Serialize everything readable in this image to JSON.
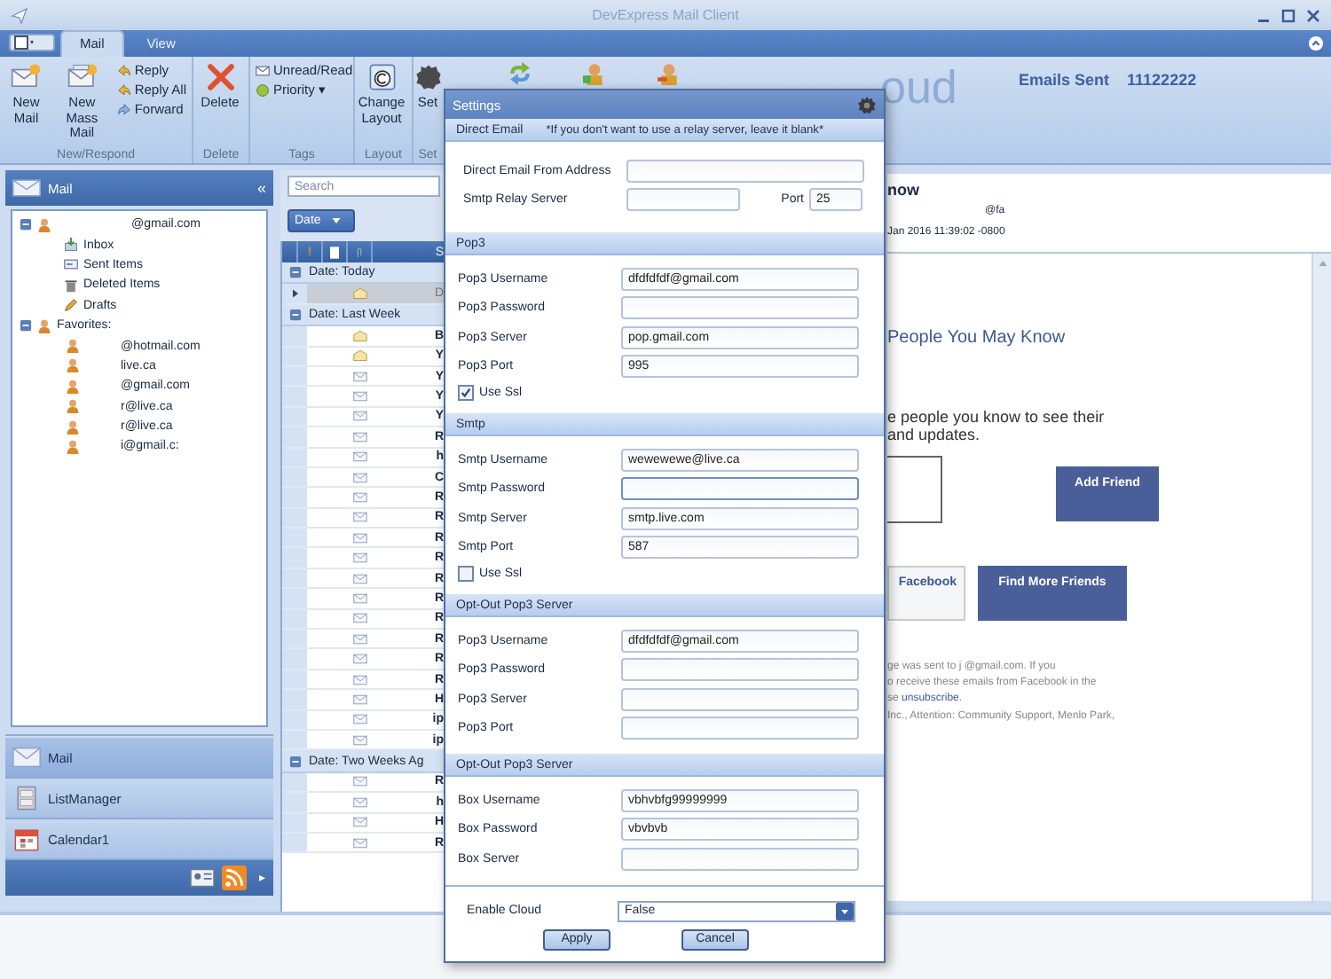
{
  "window": {
    "title": "DevExpress Mail Client"
  },
  "tabs": [
    {
      "label": "Mail",
      "selected": true
    },
    {
      "label": "View",
      "selected": false
    }
  ],
  "ribbon": {
    "groups": [
      {
        "label": "New/Respond",
        "large": [
          "New Mail",
          "New Mass Mail"
        ],
        "small": [
          "Reply",
          "Reply All",
          "Forward"
        ]
      },
      {
        "label": "Delete",
        "large": [
          "Delete"
        ]
      },
      {
        "label": "Tags",
        "small": [
          "Unread/Read",
          "Priority ▾"
        ]
      },
      {
        "label": "Layout",
        "large": [
          "Change Layout"
        ]
      },
      {
        "label": "Set",
        "large": [
          "Set"
        ]
      }
    ],
    "logo": "oud",
    "emails_sent_label": "Emails Sent",
    "emails_sent_value": "11122222"
  },
  "nav": {
    "header": "Mail",
    "collapse": "«",
    "tree": [
      {
        "label": "@gmail.com",
        "expanded": true,
        "children": [
          {
            "label": "Inbox",
            "kind": "inbox"
          },
          {
            "label": "Sent Items",
            "kind": "sent"
          },
          {
            "label": "Deleted Items",
            "kind": "deleted"
          },
          {
            "label": "Drafts",
            "kind": "drafts"
          }
        ]
      },
      {
        "label": "Favorites:",
        "expanded": true,
        "children": [
          {
            "label": "@hotmail.com",
            "kind": "contact"
          },
          {
            "label": "live.ca",
            "kind": "contact"
          },
          {
            "label": "@gmail.com",
            "kind": "contact"
          },
          {
            "label": "r@live.ca",
            "kind": "contact"
          },
          {
            "label": "r@live.ca",
            "kind": "contact"
          },
          {
            "label": "i@gmail.c:",
            "kind": "contact"
          }
        ]
      }
    ],
    "buttons": [
      {
        "label": "Mail",
        "kind": "mail"
      },
      {
        "label": "ListManager",
        "kind": "list"
      },
      {
        "label": "Calendar1",
        "kind": "calendar"
      }
    ],
    "more": "▸"
  },
  "list": {
    "search": {
      "placeholder": "Search"
    },
    "sort": "Date",
    "header": [
      "!",
      "S"
    ],
    "groups": [
      {
        "label": "Date: Today",
        "expanded": true,
        "rows": [
          {
            "sender": "D",
            "read": true,
            "selected": true
          }
        ]
      },
      {
        "label": "Date: Last Week",
        "expanded": true,
        "rows": [
          {
            "sender": "B",
            "read": true,
            "selected": false
          },
          {
            "sender": "Y",
            "read": true,
            "selected": false
          },
          {
            "sender": "Y",
            "read": false,
            "selected": false
          },
          {
            "sender": "Y",
            "read": false,
            "selected": false
          },
          {
            "sender": "Y",
            "read": false,
            "selected": false
          },
          {
            "sender": "R",
            "read": false,
            "selected": false
          },
          {
            "sender": "h",
            "read": false,
            "selected": false
          },
          {
            "sender": "C",
            "read": false,
            "selected": false
          },
          {
            "sender": "R",
            "read": false,
            "selected": false
          },
          {
            "sender": "R",
            "read": false,
            "selected": false
          },
          {
            "sender": "R",
            "read": false,
            "selected": false
          },
          {
            "sender": "R",
            "read": false,
            "selected": false
          },
          {
            "sender": "R",
            "read": false,
            "selected": false
          },
          {
            "sender": "R",
            "read": false,
            "selected": false
          },
          {
            "sender": "R",
            "read": false,
            "selected": false
          },
          {
            "sender": "R",
            "read": false,
            "selected": false
          },
          {
            "sender": "R",
            "read": false,
            "selected": false
          },
          {
            "sender": "R",
            "read": false,
            "selected": false
          },
          {
            "sender": "H",
            "read": false,
            "selected": false
          },
          {
            "sender": "ip",
            "read": false,
            "selected": false
          },
          {
            "sender": "ip",
            "read": false,
            "selected": false
          }
        ]
      },
      {
        "label": "Date: Two Weeks Ag",
        "expanded": true,
        "rows": [
          {
            "sender": "R",
            "read": false,
            "selected": false
          },
          {
            "sender": "h",
            "read": false,
            "selected": false
          },
          {
            "sender": "H",
            "read": false,
            "selected": false
          },
          {
            "sender": "R",
            "read": false,
            "selected": false
          }
        ]
      }
    ]
  },
  "reading": {
    "subject": "now",
    "from": "@fa",
    "date": "Jan 2016 11:39:02 -0800",
    "heading": "People You May Know",
    "intro": [
      "e people you know to see  their",
      "and updates."
    ],
    "add_friend": "Add Friend",
    "facebook": "Facebook",
    "find_friends": "Find More Friends",
    "footer": [
      "ge was sent to j              @gmail.com. If you",
      "o receive these emails from Facebook in the",
      "se **unsubscribe**.",
      "Inc.,  Attention: Community Support, Menlo Park,"
    ]
  },
  "settings": {
    "title": "Settings",
    "sections": [
      {
        "title": "Direct Email",
        "note": "*If you don't want to use a relay server, leave it blank*",
        "fields": [
          {
            "kind": "text",
            "label": "Direct Email From Address"
          },
          {
            "kind": "relay",
            "label": "Smtp Relay Server",
            "port_label": "Port",
            "port_value": "25"
          }
        ]
      },
      {
        "title": "Pop3",
        "fields": [
          {
            "kind": "text",
            "label": "Pop3 Username",
            "value": "dfdfdfdf@gmail.com"
          },
          {
            "kind": "text",
            "label": "Pop3 Password"
          },
          {
            "kind": "text",
            "label": "Pop3 Server",
            "value": "pop.gmail.com"
          },
          {
            "kind": "text",
            "label": "Pop3 Port",
            "value": "995"
          },
          {
            "kind": "checkbox",
            "label": "Use Ssl",
            "checked": true
          }
        ]
      },
      {
        "title": "Smtp",
        "fields": [
          {
            "kind": "text",
            "label": "Smtp Username",
            "value": "wewewewe@live.ca"
          },
          {
            "kind": "text",
            "label": "Smtp Password",
            "focused": true
          },
          {
            "kind": "text",
            "label": "Smtp Server",
            "value": "smtp.live.com"
          },
          {
            "kind": "text",
            "label": "Smtp Port",
            "value": "587"
          },
          {
            "kind": "checkbox",
            "label": "Use Ssl",
            "checked": false
          }
        ]
      },
      {
        "title": "Opt-Out Pop3 Server",
        "fields": [
          {
            "kind": "text",
            "label": "Pop3 Username",
            "value": "dfdfdfdf@gmail.com"
          },
          {
            "kind": "text",
            "label": "Pop3 Password"
          },
          {
            "kind": "text",
            "label": "Pop3 Server"
          },
          {
            "kind": "text",
            "label": "Pop3 Port"
          }
        ]
      },
      {
        "title": "Opt-Out Pop3 Server",
        "fields": [
          {
            "kind": "text",
            "label": "Box Username",
            "value": "vbhvbfg99999999"
          },
          {
            "kind": "text",
            "label": "Box Password",
            "value": "vbvbvb"
          },
          {
            "kind": "text",
            "label": "Box Server"
          }
        ]
      }
    ],
    "cloud_label": "Enable Cloud",
    "cloud_value": "False",
    "apply": "Apply",
    "cancel": "Cancel"
  }
}
